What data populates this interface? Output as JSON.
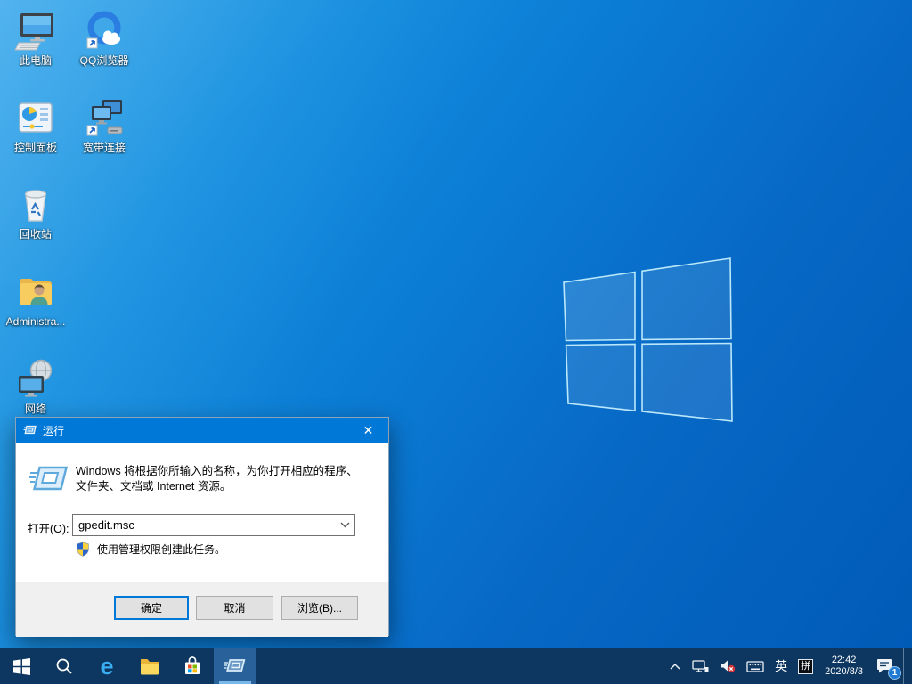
{
  "desktop_icons": [
    {
      "label": "此电脑"
    },
    {
      "label": "QQ浏览器"
    },
    {
      "label": "控制面板"
    },
    {
      "label": "宽带连接"
    },
    {
      "label": "回收站"
    },
    {
      "label": "Administra..."
    },
    {
      "label": "网络"
    }
  ],
  "run_dialog": {
    "title": "运行",
    "close": "✕",
    "description_line1": "Windows 将根据你所输入的名称，为你打开相应的程序、",
    "description_line2": "文件夹、文档或 Internet 资源。",
    "open_label": "打开(O):",
    "input_value": "gpedit.msc",
    "admin_note": "使用管理权限创建此任务。",
    "ok": "确定",
    "cancel": "取消",
    "browse": "浏览(B)..."
  },
  "taskbar": {
    "tray": {
      "lang": "英",
      "ime": "拼",
      "time": "22:42",
      "date": "2020/8/3",
      "notification_count": "1"
    }
  },
  "colors": {
    "accent": "#0078d7",
    "taskbar": "#0d3760"
  }
}
